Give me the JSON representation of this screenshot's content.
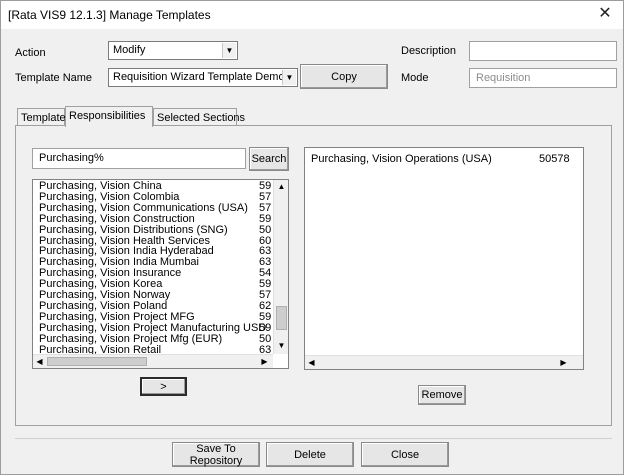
{
  "window": {
    "title": "[Rata VIS9 12.1.3] Manage Templates",
    "close_glyph": "✕"
  },
  "form": {
    "action_label": "Action",
    "action_value": "Modify",
    "template_name_label": "Template Name",
    "template_name_value": "Requisition Wizard Template Demo",
    "copy_button": "Copy",
    "description_label": "Description",
    "description_value": "",
    "mode_label": "Mode",
    "mode_value": "Requisition"
  },
  "tabs": [
    {
      "label": "Template"
    },
    {
      "label": "Responsibilities"
    },
    {
      "label": "Selected Sections"
    }
  ],
  "search": {
    "value": "Purchasing%",
    "button": "Search"
  },
  "available_list": {
    "items": [
      {
        "name": "Purchasing, Vision China",
        "id": "59"
      },
      {
        "name": "Purchasing, Vision Colombia",
        "id": "57"
      },
      {
        "name": "Purchasing, Vision Communications (USA)",
        "id": "57"
      },
      {
        "name": "Purchasing, Vision Construction",
        "id": "59"
      },
      {
        "name": "Purchasing, Vision Distributions (SNG)",
        "id": "50"
      },
      {
        "name": "Purchasing, Vision Health Services",
        "id": "60"
      },
      {
        "name": "Purchasing, Vision India Hyderabad",
        "id": "63"
      },
      {
        "name": "Purchasing, Vision India Mumbai",
        "id": "63"
      },
      {
        "name": "Purchasing, Vision Insurance",
        "id": "54"
      },
      {
        "name": "Purchasing, Vision Korea",
        "id": "59"
      },
      {
        "name": "Purchasing, Vision Norway",
        "id": "57"
      },
      {
        "name": "Purchasing, Vision Poland",
        "id": "62"
      },
      {
        "name": "Purchasing, Vision Project MFG",
        "id": "59"
      },
      {
        "name": "Purchasing, Vision Project Manufacturing USD",
        "id": "59"
      },
      {
        "name": "Purchasing, Vision Project Mfg (EUR)",
        "id": "50"
      },
      {
        "name": "Purchasing, Vision Retail",
        "id": "63"
      }
    ]
  },
  "move_button": ">",
  "selected_list": {
    "items": [
      {
        "name": "Purchasing, Vision Operations (USA)",
        "id": "50578"
      }
    ]
  },
  "remove_button": "Remove",
  "footer": {
    "save_button": "Save To Repository",
    "delete_button": "Delete",
    "close_button": "Close"
  },
  "icons": {
    "dropdown": "▼",
    "scroll_up": "▲",
    "scroll_down": "▼",
    "scroll_left": "◀",
    "scroll_right": "▶"
  }
}
